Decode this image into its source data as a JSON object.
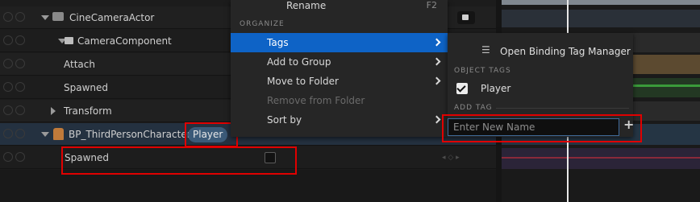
{
  "outliner": {
    "rows": [
      {
        "label": "CineCameraActor"
      },
      {
        "label": "CameraComponent"
      },
      {
        "label": "Attach"
      },
      {
        "label": "Spawned"
      },
      {
        "label": "Transform"
      },
      {
        "label": "BP_ThirdPersonCharacter",
        "tag": "Player"
      },
      {
        "label": "Spawned"
      }
    ]
  },
  "context_menu": {
    "rename": "Rename",
    "rename_shortcut": "F2",
    "section_organize": "ORGANIZE",
    "items": [
      {
        "label": "Tags"
      },
      {
        "label": "Add to Group"
      },
      {
        "label": "Move to Folder"
      },
      {
        "label": "Remove from Folder"
      },
      {
        "label": "Sort by"
      }
    ]
  },
  "tags_submenu": {
    "open_manager": "Open Binding Tag Manager",
    "section_object_tags": "OBJECT TAGS",
    "tags": [
      {
        "label": "Player",
        "checked": true
      }
    ],
    "section_add_tag": "ADD TAG",
    "new_tag_placeholder": "Enter New Name"
  },
  "colors": {
    "highlight": "#0e63c6",
    "annotation": "#e00000",
    "tag_pill": "#3b5a78"
  }
}
